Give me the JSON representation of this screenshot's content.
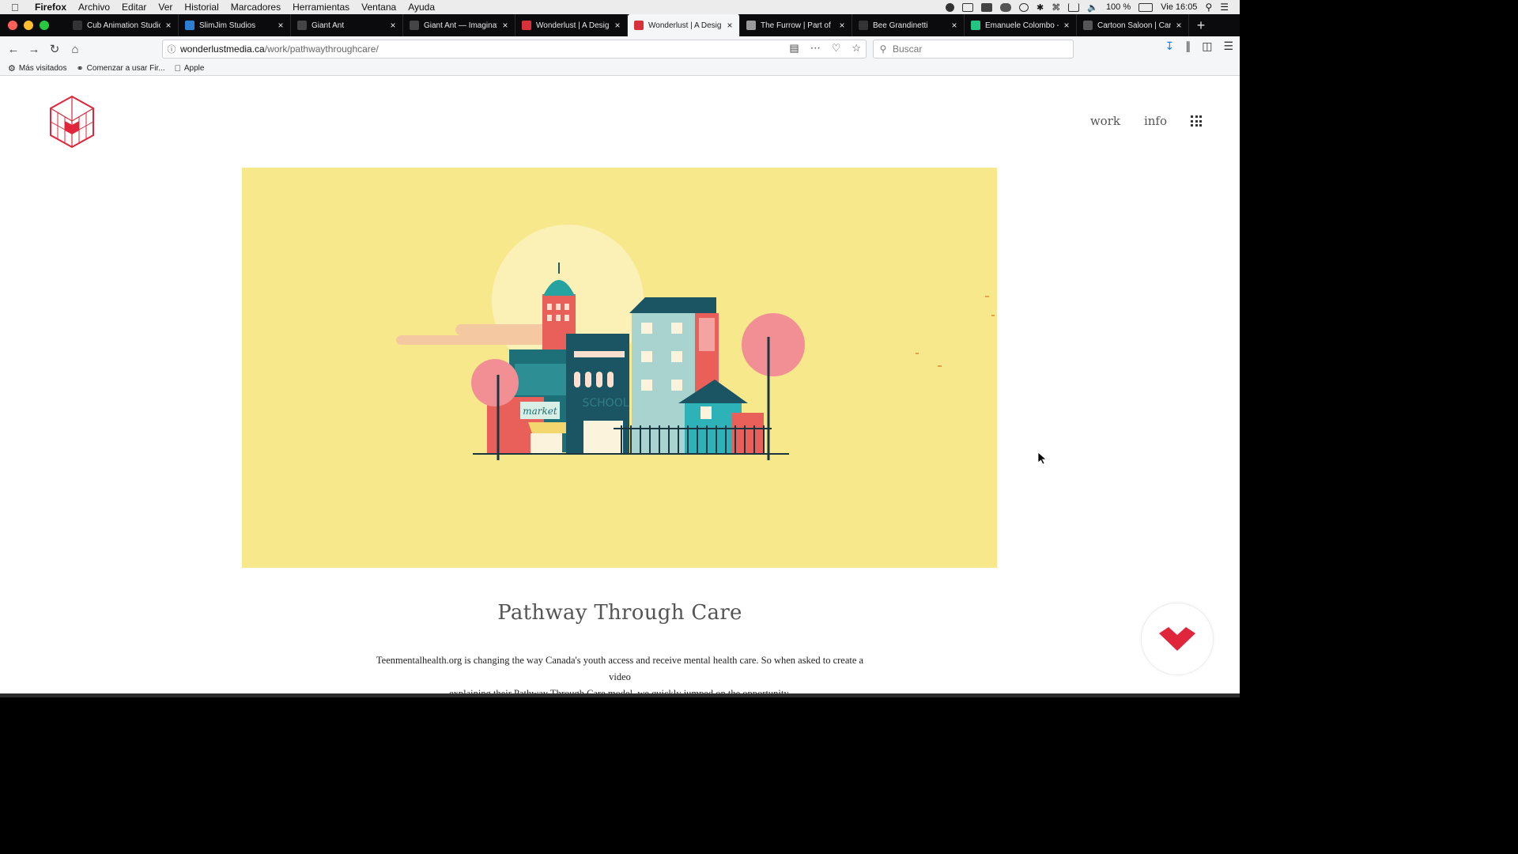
{
  "menubar": {
    "app_name": "Firefox",
    "items": [
      "Archivo",
      "Editar",
      "Ver",
      "Historial",
      "Marcadores",
      "Herramientas",
      "Ventana",
      "Ayuda"
    ],
    "battery": "100 %",
    "clock": "Vie 16:05"
  },
  "tabs": [
    {
      "title": "Cub Animation Studio",
      "favicon_color": "#333333",
      "active": false
    },
    {
      "title": "SlimJim Studios",
      "favicon_color": "#2b7fd6",
      "active": false
    },
    {
      "title": "Giant Ant",
      "favicon_color": "#444444",
      "active": false
    },
    {
      "title": "Giant Ant — Imaginat",
      "favicon_color": "#444444",
      "active": false
    },
    {
      "title": "Wonderlust | A Desig",
      "favicon_color": "#d8313d",
      "active": false
    },
    {
      "title": "Wonderlust | A Desig",
      "favicon_color": "#d8313d",
      "active": true
    },
    {
      "title": "The Furrow | Part of",
      "favicon_color": "#999999",
      "active": false
    },
    {
      "title": "Bee Grandinetti",
      "favicon_color": "#333333",
      "active": false
    },
    {
      "title": "Emanuele Colombo -",
      "favicon_color": "#21c483",
      "active": false
    },
    {
      "title": "Cartoon Saloon | Car",
      "favicon_color": "#555555",
      "active": false
    }
  ],
  "urlbar": {
    "domain": "wonderlustmedia.ca",
    "path": "/work/pathwaythroughcare/"
  },
  "searchbar": {
    "placeholder": "Buscar"
  },
  "bookmarks": [
    {
      "label": "Más visitados",
      "icon": "gear-icon"
    },
    {
      "label": "Comenzar a usar Fir...",
      "icon": "globe-icon"
    },
    {
      "label": "Apple",
      "icon": "apple-icon"
    }
  ],
  "site": {
    "nav": {
      "work": "work",
      "info": "info"
    },
    "brand_color": "#e0263a",
    "project_title": "Pathway Through Care",
    "description_line1": "Teenmentalhealth.org is changing the way Canada's youth access and receive mental health care. So when asked to create a video",
    "description_line2": "explaining their Pathway Through Care model, we quickly jumped on the opportunity.",
    "hero_background": "#f7e88b",
    "hero_sign_market": "market",
    "hero_sign_school": "SCHOOL"
  }
}
